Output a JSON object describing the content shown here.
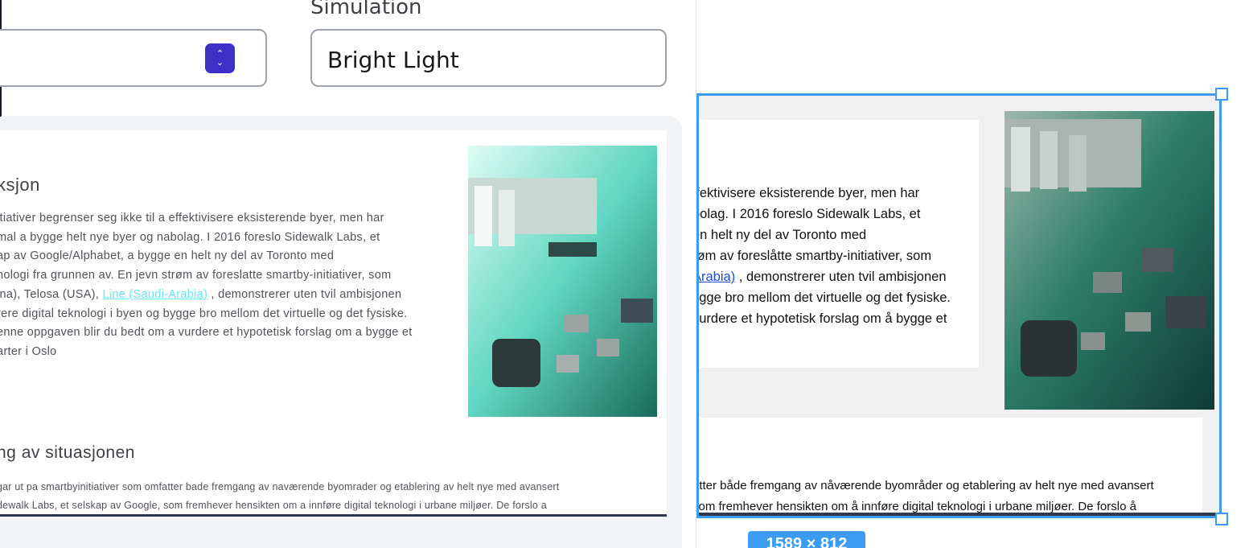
{
  "settings": {
    "field_label": "Simulation",
    "select_one_value": "",
    "select_two_value": "Bright Light"
  },
  "preview": {
    "heading_intro": "ksjon",
    "para_lines": [
      "itiativer begrenser seg ikke til a effektivisere eksisterende byer, men har",
      "mal a bygge helt nye byer og nabolag. I 2016 foreslo Sidewalk Labs, et",
      "ap av Google/Alphabet, a bygge en helt ny del av Toronto med",
      "nologi fra grunnen av. En jevn strøm av foreslatte smartby-initiativer, som",
      "ina), Telosa (USA), ",
      "rere digital teknologi i byen og bygge bro mellom det virtuelle og det fysiske.",
      "enne oppgaven blir du bedt om a vurdere et hypotetisk forslag om a bygge et",
      "arter i Oslo"
    ],
    "link_text": "Line (Saudi-Arabia)",
    "link_after": " , demonstrerer uten tvil ambisjonen",
    "heading_situation": "ng av situasjonen",
    "para2_lines": [
      "gar ut pa smartbyinitiativer som omfatter bade fremgang av naværende byomrader og etablering av helt nye med avansert",
      "dewalk Labs, et selskap av Google, som fremhever hensikten om a innføre digital teknologi i urbane miljøer. De forslo a"
    ]
  },
  "canvas": {
    "card_lines": [
      "ffektivisere eksisterende byer, men har",
      "bolag. I 2016 foreslo Sidewalk Labs, et",
      " en helt ny del av Toronto med",
      "røm av foreslåtte smartby-initiativer, som"
    ],
    "card_link": "Arabia)",
    "card_link_after": " , demonstrerer uten tvil ambisjonen",
    "card_lines_2": [
      "ygge bro mellom det virtuelle og det fysiske.",
      " vurdere et hypotetisk forslag om å bygge et"
    ],
    "card2_lines": [
      "atter både fremgang av nåværende byområder og etablering av helt nye med avansert",
      "som fremhever hensikten om å innføre digital teknologi i urbane miljøer. De forslo å"
    ],
    "dimension_badge": "1589 × 812"
  },
  "icons": {
    "select_chevron": "chevron-up-down-icon",
    "image": "circuit-board-image"
  },
  "colors": {
    "accent": "#3e2fc7",
    "selection": "#3b9cf2",
    "link_sim": "#67e8f9",
    "link_orig": "#1d4ed8"
  }
}
